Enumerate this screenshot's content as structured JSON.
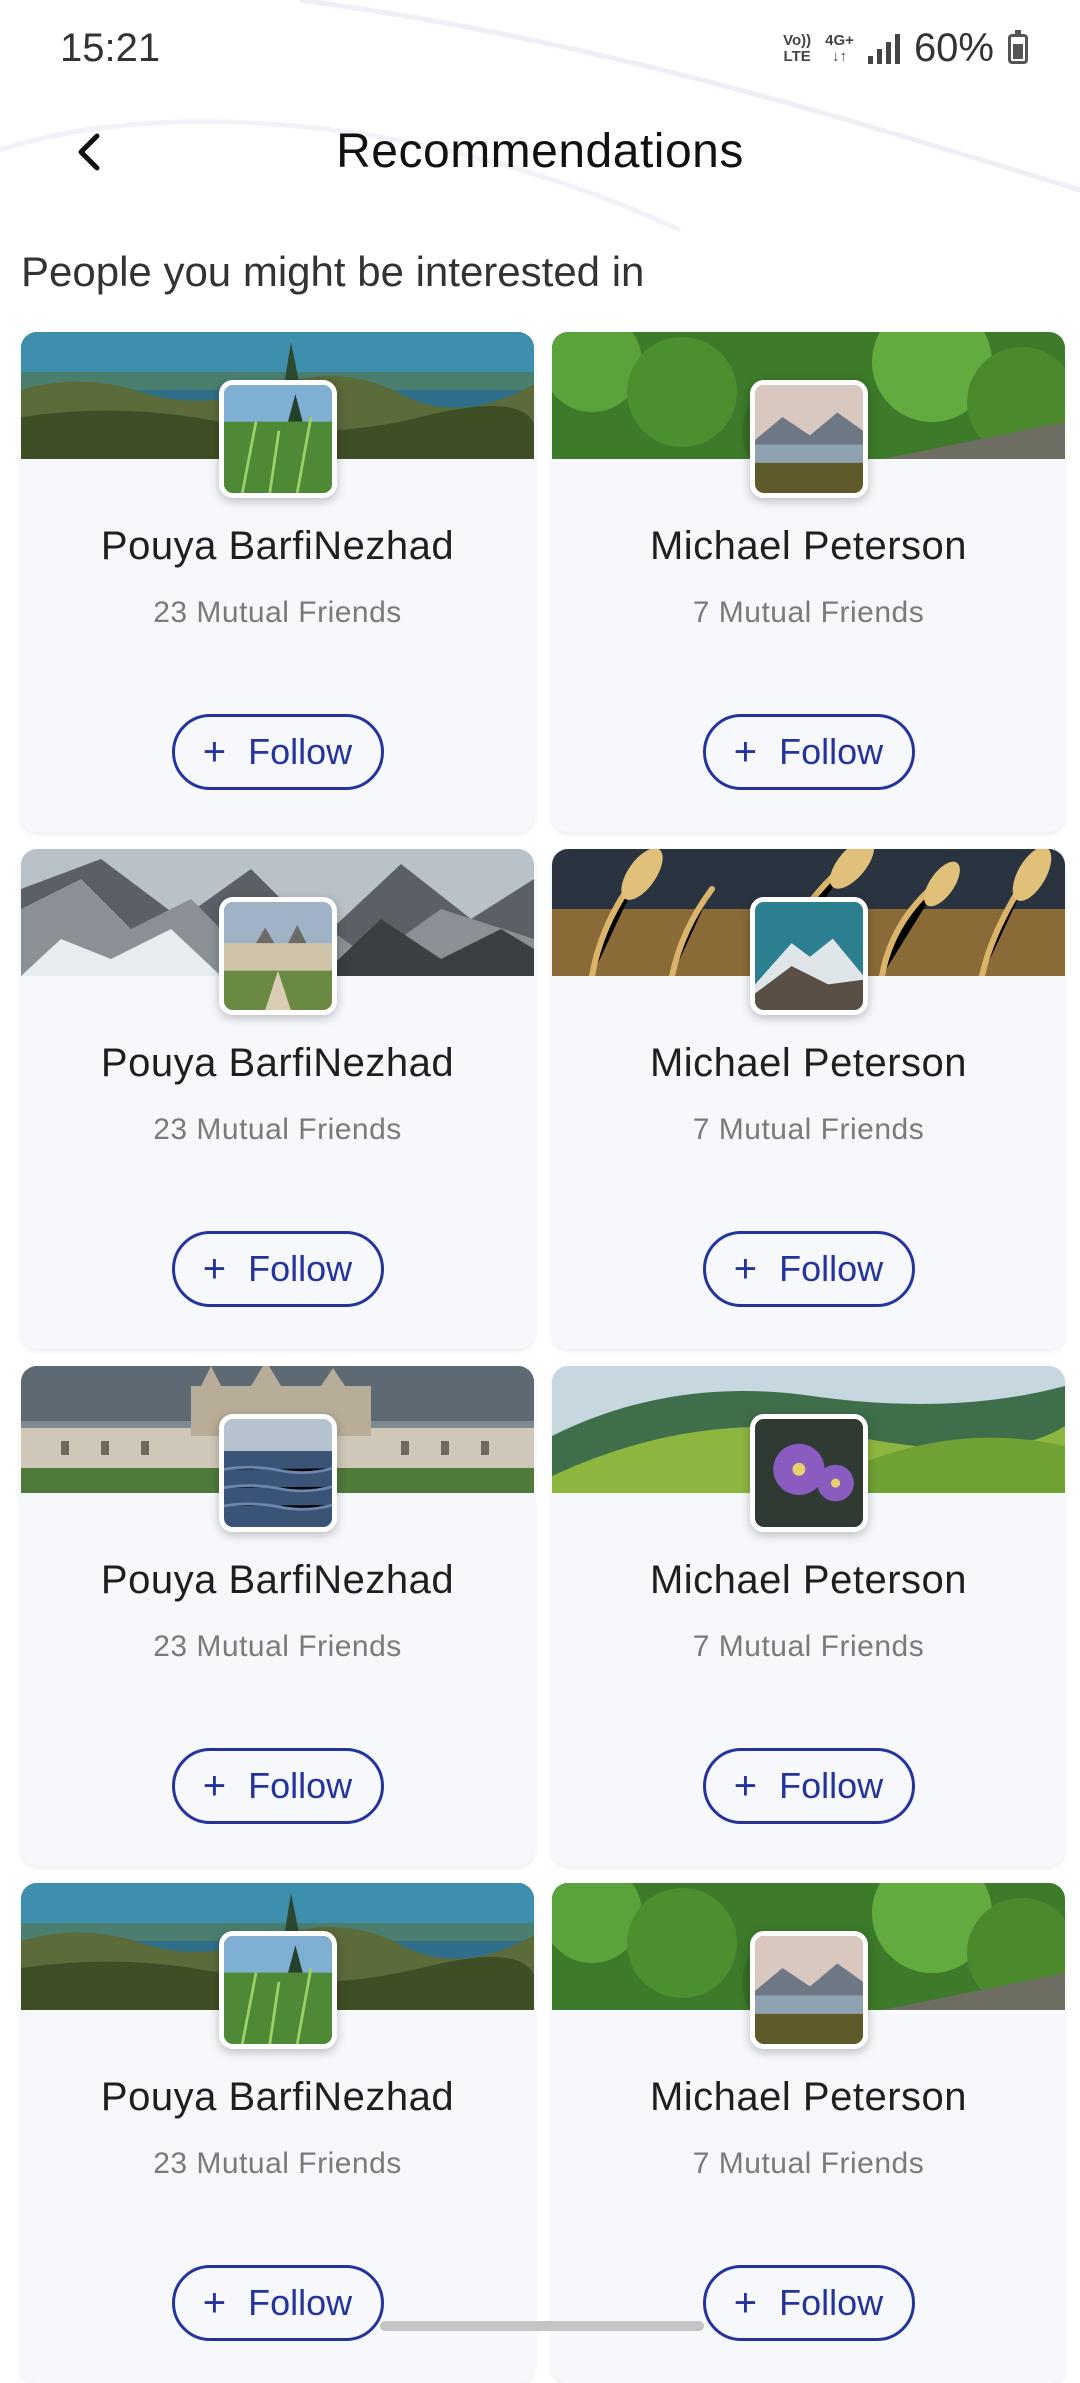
{
  "status_bar": {
    "time": "15:21",
    "volte_top": "Vo))",
    "volte_bottom": "LTE",
    "network_top": "4G+",
    "network_bottom": "↓↑",
    "battery": "60%"
  },
  "header": {
    "back_icon": "chevron-left-icon",
    "title": "Recommendations"
  },
  "section": {
    "title": "People you might be interested in"
  },
  "cards": [
    {
      "name": "Pouya BarfiNezhad",
      "mutual": "23 Mutual Friends",
      "follow_label": "Follow",
      "cover": "lake-grass",
      "avatar": "meadow"
    },
    {
      "name": "Michael Peterson",
      "mutual": "7 Mutual Friends",
      "follow_label": "Follow",
      "cover": "green-forest",
      "avatar": "mountain-lake"
    },
    {
      "name": "Pouya BarfiNezhad",
      "mutual": "23 Mutual Friends",
      "follow_label": "Follow",
      "cover": "snowy-mountains",
      "avatar": "chateau"
    },
    {
      "name": "Michael Peterson",
      "mutual": "7 Mutual Friends",
      "follow_label": "Follow",
      "cover": "wheat-field",
      "avatar": "snow-peak"
    },
    {
      "name": "Pouya BarfiNezhad",
      "mutual": "23 Mutual Friends",
      "follow_label": "Follow",
      "cover": "chateau",
      "avatar": "sea-water"
    },
    {
      "name": "Michael Peterson",
      "mutual": "7 Mutual Friends",
      "follow_label": "Follow",
      "cover": "green-hills",
      "avatar": "purple-flowers"
    },
    {
      "name": "Pouya BarfiNezhad",
      "mutual": "23 Mutual Friends",
      "follow_label": "Follow",
      "cover": "lake-grass",
      "avatar": "meadow"
    },
    {
      "name": "Michael Peterson",
      "mutual": "7 Mutual Friends",
      "follow_label": "Follow",
      "cover": "green-forest",
      "avatar": "mountain-lake"
    }
  ],
  "colors": {
    "accent": "#24349a",
    "card_bg": "#f7f8fc",
    "muted_text": "#7a7a7a"
  }
}
